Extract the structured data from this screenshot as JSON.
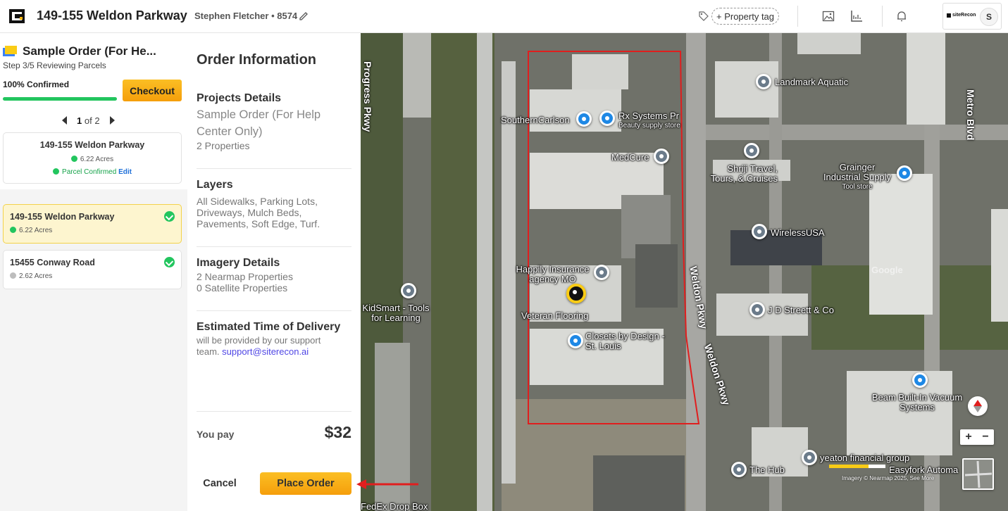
{
  "header": {
    "title": "149-155 Weldon Parkway",
    "user": "Stephen Fletcher • 8574",
    "property_tag": "+ Property tag",
    "account_logo_text": "siteRecon",
    "avatar": "S"
  },
  "sidebar": {
    "order_title": "Sample Order (For He...",
    "step": "Step 3/5 Reviewing Parcels",
    "confirmed_label": "100% Confirmed",
    "progress_pct": 100,
    "checkout_label": "Checkout",
    "pager": {
      "current": "1",
      "of": "of 2"
    },
    "current_property": {
      "name": "149-155 Weldon Parkway",
      "acres": "6.22 Acres",
      "status": "Parcel Confirmed",
      "edit": "Edit"
    },
    "items": [
      {
        "name": "149-155 Weldon Parkway",
        "acres": "6.22 Acres",
        "confirmed": true,
        "selected": true
      },
      {
        "name": "15455 Conway Road",
        "acres": "2.62 Acres",
        "confirmed": true,
        "selected": false
      }
    ]
  },
  "order": {
    "title": "Order Information",
    "projects_heading": "Projects Details",
    "project_name": "Sample Order (For Help Center Only)",
    "project_props": "2 Properties",
    "layers_heading": "Layers",
    "layers_text": "All Sidewalks, Parking Lots, Driveways, Mulch Beds, Pavements, Soft Edge, Turf.",
    "imagery_heading": "Imagery Details",
    "imagery_line1": "2 Nearmap Properties",
    "imagery_line2": "0 Satellite Properties",
    "eta_heading": "Estimated Time of Delivery",
    "eta_text": "will be provided by our support team.",
    "eta_email": "support@siterecon.ai",
    "you_pay_label": "You pay",
    "price": "$32",
    "cancel_label": "Cancel",
    "place_order_label": "Place Order"
  },
  "map": {
    "roads": [
      "Progress Pkwy",
      "Weldon Pkwy",
      "Weldon Pkwy",
      "Metro Blvd"
    ],
    "places": [
      {
        "name": "Landmark Aquatic",
        "type": "grey"
      },
      {
        "name": "SouthernCarlson",
        "type": "blue"
      },
      {
        "name": "Rx Systems Pr",
        "sub": "Beauty supply store",
        "type": "blue"
      },
      {
        "name": "MedCure",
        "type": "grey"
      },
      {
        "name": "Shriji Travel, Tours, & Cruises",
        "type": "grey"
      },
      {
        "name": "Grainger Industrial Supply",
        "sub": "Tool store",
        "type": "blue"
      },
      {
        "name": "WirelessUSA",
        "type": "grey"
      },
      {
        "name": "Happily Insurance agency MO",
        "type": "grey"
      },
      {
        "name": "Veteran Flooring",
        "type": "yellow"
      },
      {
        "name": "KidSmart - Tools for Learning",
        "type": "grey"
      },
      {
        "name": "J D Streett & Co",
        "type": "grey"
      },
      {
        "name": "Closets by Design - St. Louis",
        "type": "blue"
      },
      {
        "name": "Beam Built-In Vacuum Systems",
        "type": "blue"
      },
      {
        "name": "yeaton financial group",
        "type": "grey"
      },
      {
        "name": "Easyfork Automa",
        "type": "grey"
      },
      {
        "name": "The Hub",
        "type": "grey"
      },
      {
        "name": "FedEx Drop Box",
        "type": "grey"
      }
    ],
    "watermark": "Google",
    "attribution": "Imagery © Nearmap 2025, See More",
    "zoom_in": "+",
    "zoom_out": "−"
  },
  "colors": {
    "accent": "#f5b50f",
    "success": "#22c55e",
    "parcel": "#e01e1e",
    "link": "#4f46e5"
  }
}
